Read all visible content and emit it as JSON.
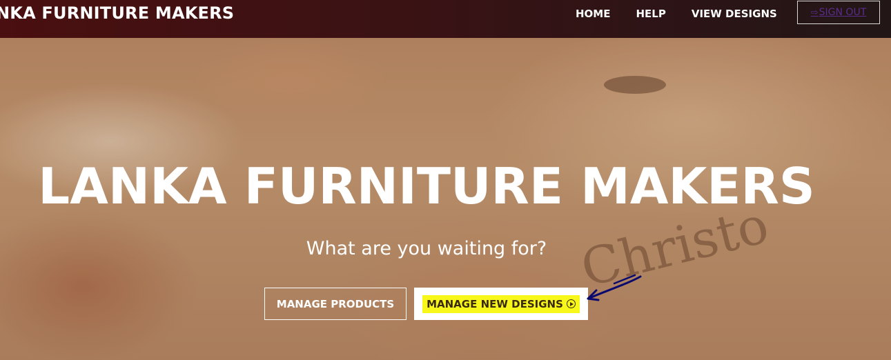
{
  "navbar": {
    "brand": "NKA FURNITURE MAKERS",
    "links": [
      "HOME",
      "HELP",
      "VIEW DESIGNS"
    ],
    "signout_label": "SIGN OUT",
    "signout_icon": "sign-out-icon"
  },
  "hero": {
    "title": "LANKA FURNITURE MAKERS",
    "subtitle": "What are you waiting for?",
    "engraving": "Christo",
    "buttons": {
      "manage_products": "MANAGE PRODUCTS",
      "manage_new_designs": "MANAGE NEW DESIGNS"
    }
  },
  "colors": {
    "navbar_start": "#4a0f10",
    "navbar_end": "#221617",
    "highlight": "#f7f71a",
    "annotation_arrow": "#0a0a6e"
  }
}
